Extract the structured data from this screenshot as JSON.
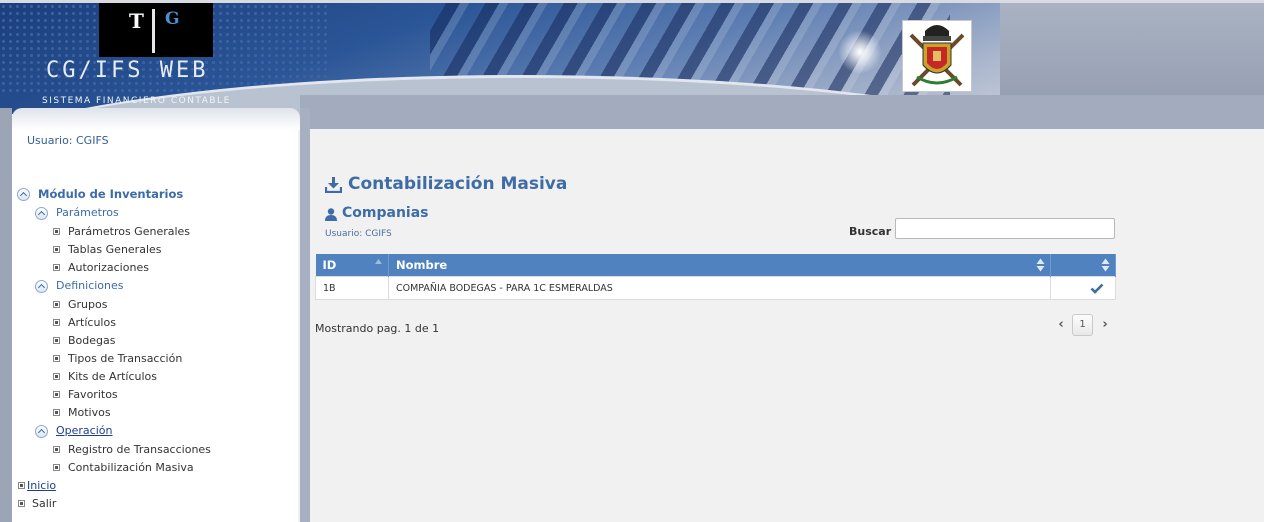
{
  "header": {
    "logo_t": "T",
    "logo_g": "G",
    "app_title": "CG/IFS WEB",
    "app_subtitle": "SISTEMA FINANCIERO CONTABLE"
  },
  "sidebar": {
    "user": "Usuario: CGIFS",
    "module": "Módulo de Inventarios",
    "sections": [
      {
        "label": "Parámetros",
        "items": [
          "Parámetros Generales",
          "Tablas Generales",
          "Autorizaciones"
        ]
      },
      {
        "label": "Definiciones",
        "items": [
          "Grupos",
          "Artículos",
          "Bodegas",
          "Tipos de Transacción",
          "Kits de Artículos",
          "Favoritos",
          "Motivos"
        ]
      },
      {
        "label": "Operación",
        "items": [
          "Registro de Transacciones",
          "Contabilización Masiva"
        ]
      }
    ],
    "inicio": "Inicio",
    "salir": "Salir"
  },
  "main": {
    "title": "Contabilización Masiva",
    "section": "Companias",
    "user": "Usuario: CGIFS",
    "search_label": "Buscar",
    "search_value": "",
    "columns": [
      "ID",
      "Nombre",
      ""
    ],
    "rows": [
      {
        "id": "1B",
        "nombre": "COMPAÑIA BODEGAS - PARA 1C ESMERALDAS",
        "selected": true
      }
    ],
    "status": "Mostrando pag. 1 de 1",
    "pager": {
      "current": "1"
    }
  },
  "colors": {
    "accent": "#3e6da6",
    "grid_header": "#4f82bf"
  }
}
